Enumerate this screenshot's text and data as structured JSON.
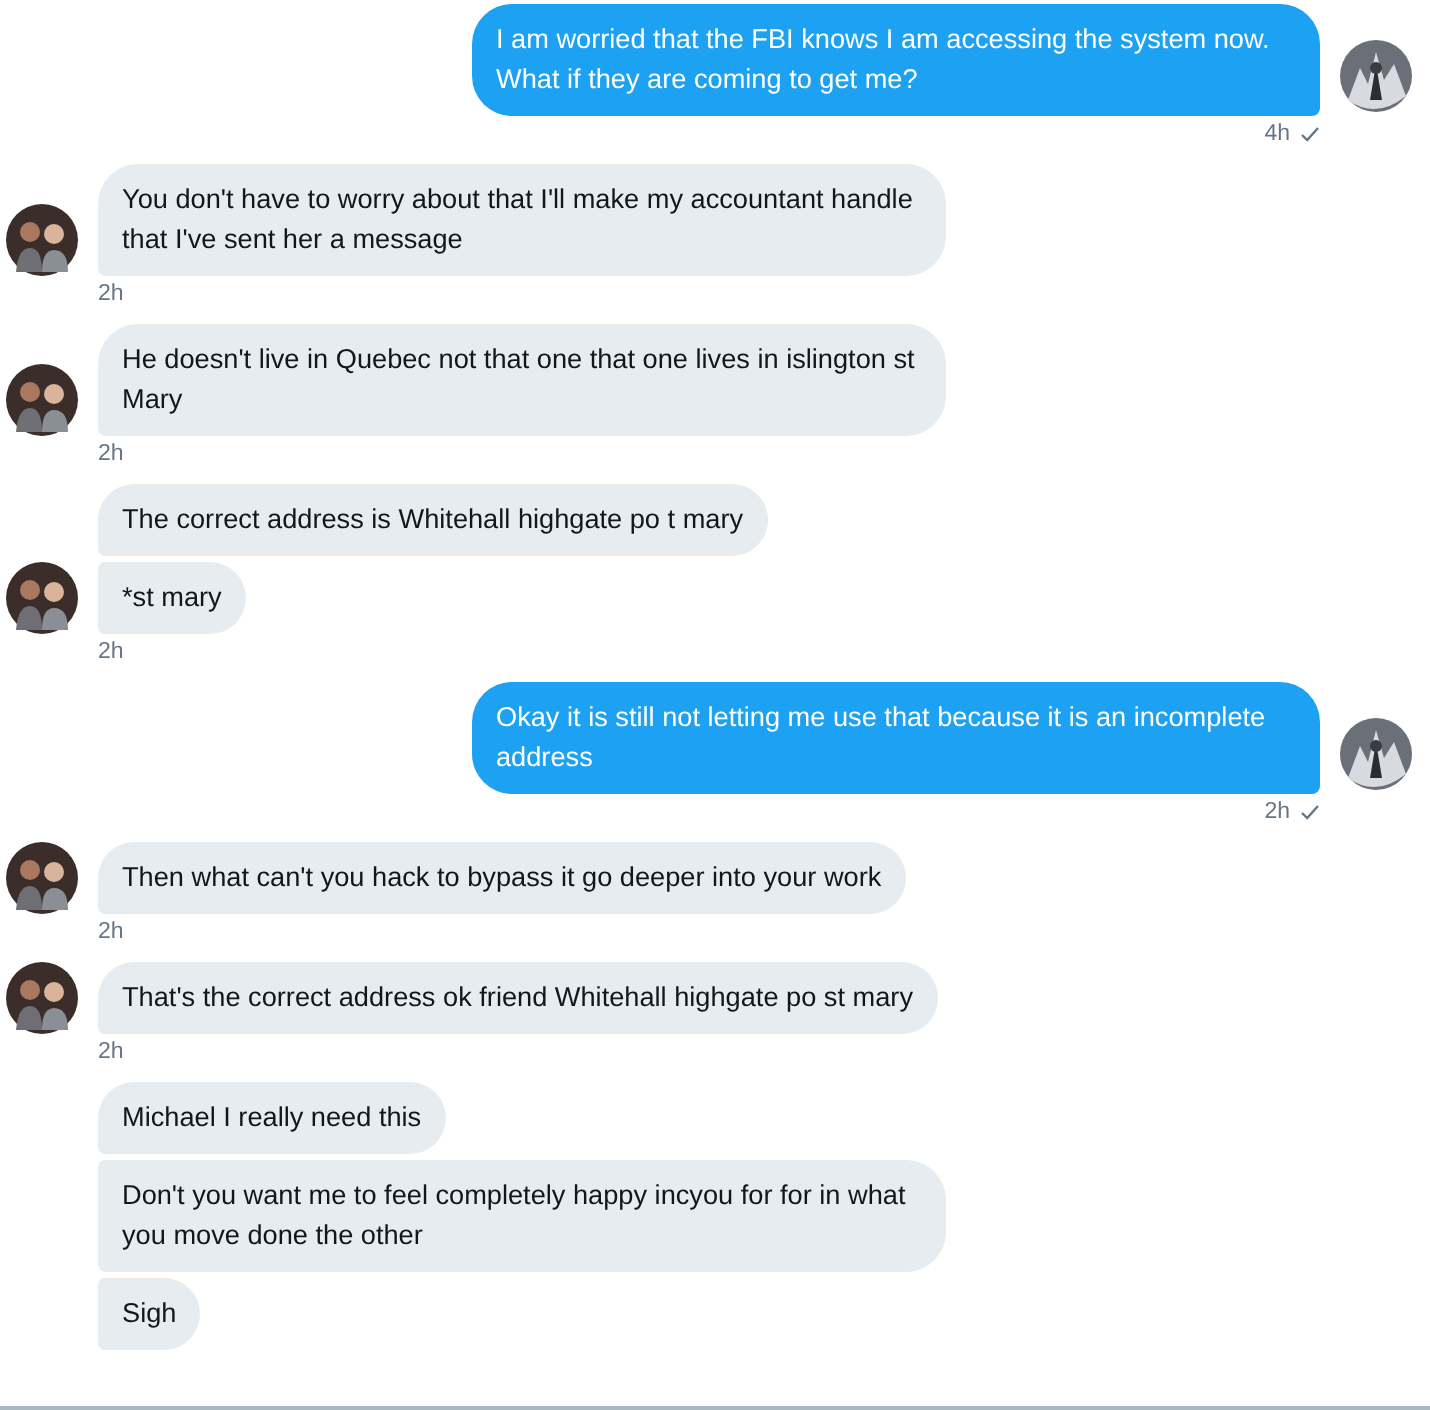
{
  "conversation": [
    {
      "kind": "outgoing",
      "avatar": true,
      "time": "4h",
      "read": true,
      "messages": [
        "I am worried that the FBI knows I am accessing the system now. What if they are coming to get me?"
      ]
    },
    {
      "kind": "incoming",
      "avatar": true,
      "time": "2h",
      "messages": [
        "You don't have to worry about that I'll make my accountant handle that I've sent her a message"
      ]
    },
    {
      "kind": "incoming",
      "avatar": true,
      "time": "2h",
      "messages": [
        "He doesn't live in Quebec not that one that one lives in islington st Mary"
      ]
    },
    {
      "kind": "incoming",
      "avatar": true,
      "time": "2h",
      "messages": [
        "The correct address is Whitehall highgate po t mary",
        "*st mary"
      ]
    },
    {
      "kind": "outgoing",
      "avatar": true,
      "time": "2h",
      "read": true,
      "messages": [
        "Okay it is still not letting me use that because it is an incomplete address"
      ]
    },
    {
      "kind": "incoming",
      "avatar": true,
      "time": "2h",
      "messages": [
        "Then what can't you hack to bypass it go deeper into your work"
      ]
    },
    {
      "kind": "incoming",
      "avatar": true,
      "time": "2h",
      "messages": [
        "That's the correct address ok friend Whitehall highgate po st mary"
      ]
    },
    {
      "kind": "incoming",
      "messages": [
        "Michael I really need this",
        "Don't you want me to feel completely happy incyou for for in what you move done the other",
        "Sigh"
      ]
    }
  ]
}
